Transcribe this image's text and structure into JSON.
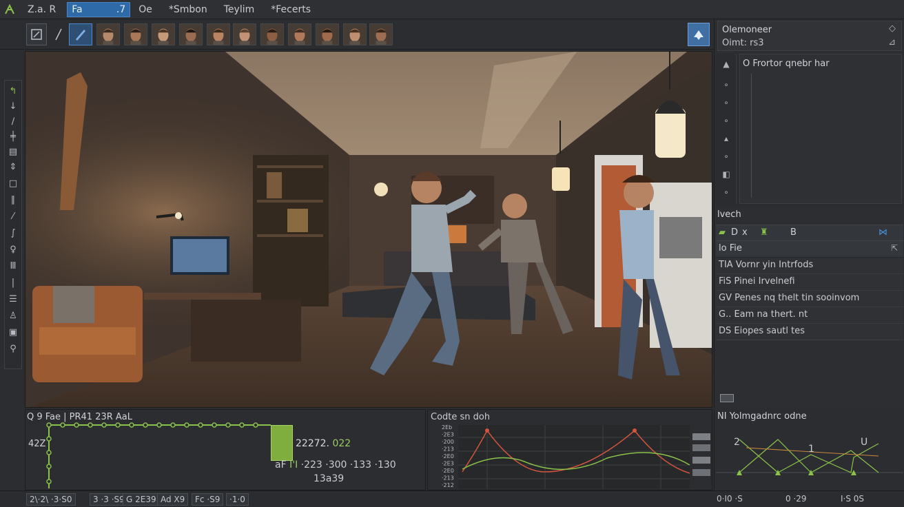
{
  "menubar": {
    "app_title": "Z.a. R",
    "field_value": "Fa",
    "field_suffix": ".7",
    "items": [
      "Oe",
      "*Smbon",
      "Teylim",
      "*Fecerts"
    ]
  },
  "toolbar": {
    "faces_count_label": ""
  },
  "outliner": {
    "title": "Olemoneer",
    "subtitle": "Oimt: rs3",
    "tree_root": "O  Frortor qnebr har"
  },
  "props": {
    "search_title": "lvech",
    "tab_d": "D",
    "tab_x": "x",
    "tab_b": "B",
    "file_label": "lo Fie",
    "items": [
      "TIA Vornr yin Intrfods",
      "FiS Pinei Irvelnefi",
      "GV Penes nq thelt tin sooinvom",
      "G.. Eam na thert. nt",
      "DS Eiopes sautl tes"
    ]
  },
  "timeline": {
    "title": "Q  9 Fae  |  PR41 23R  AaL",
    "ylabel": "42Z",
    "readout1": "22272.",
    "readout1_green": "022",
    "readout2_prefix": "aF",
    "readout2_green": "I'I",
    "readout2": "·223  ·300  ·133  ·130",
    "readout3": "13a39"
  },
  "graph": {
    "title": "Codte sn doh",
    "tick_labels": [
      "2Eb",
      "·2E3",
      "·200",
      "·213",
      "·2E0",
      "·2E3",
      "·2E0",
      "·213",
      "·212"
    ]
  },
  "minigraph": {
    "title": "NI Yolmgadnrc odne",
    "label_left": "2",
    "label_mid": "1",
    "label_right": "U"
  },
  "status": {
    "items": [
      "2\\·2\\ ·3·S0",
      "3 ·3 ·S9",
      "G 2E39",
      "Ad X9",
      "Fc ·S9",
      "·1·0"
    ],
    "right_left": "0·I0 ·S",
    "right_mid": "0 ·29",
    "right_right": "I·S 0S"
  },
  "colors": {
    "accent_blue": "#2f6aa8",
    "key_green": "#8bc34a",
    "curve_red": "#d2553f",
    "curve_green": "#8bc34a"
  }
}
